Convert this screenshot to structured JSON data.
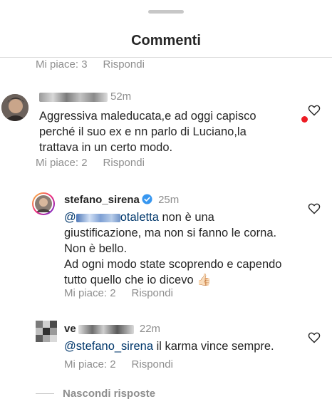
{
  "sheet": {
    "title": "Commenti"
  },
  "colors": {
    "mention": "#00376b",
    "meta": "#8e8e8e",
    "notification_dot": "#ed1c24",
    "verified": "#3897f0"
  },
  "top_comment": {
    "likes_label": "Mi piace: 3",
    "reply_label": "Rispondi"
  },
  "comment1": {
    "username_visible": "... tal",
    "time": "52m",
    "text_line1": "Aggressiva maleducata,e ad oggi capisco",
    "text_line2": "perché il suo ex e nn parlo di Luciano,la",
    "text_line3": "trattava in un certo modo.",
    "likes_label": "Mi piace: 2",
    "reply_label": "Rispondi",
    "like_icon": "heart-outline-icon"
  },
  "reply1": {
    "username": "stefano_sirena",
    "verified": true,
    "time": "25m",
    "mention_visible": "@",
    "mention_tail": "otaletta",
    "text_line1_rest": " non è una",
    "text_line2": "giustificazione, ma non si fanno le corna.",
    "text_line3": "Non è bello.",
    "text_line4": "Ad ogni modo state scoprendo e capendo",
    "text_line5": "tutto quello che io dicevo 👍🏻",
    "likes_label": "Mi piace: 2",
    "reply_label": "Rispondi",
    "like_icon": "heart-outline-icon"
  },
  "reply2": {
    "username_visible": "ve",
    "time": "22m",
    "mention": "@stefano_sirena",
    "text_rest": " il karma vince sempre.",
    "likes_label": "Mi piace: 2",
    "reply_label": "Rispondi",
    "like_icon": "heart-outline-icon"
  },
  "footer": {
    "hide_replies_label": "Nascondi risposte"
  }
}
